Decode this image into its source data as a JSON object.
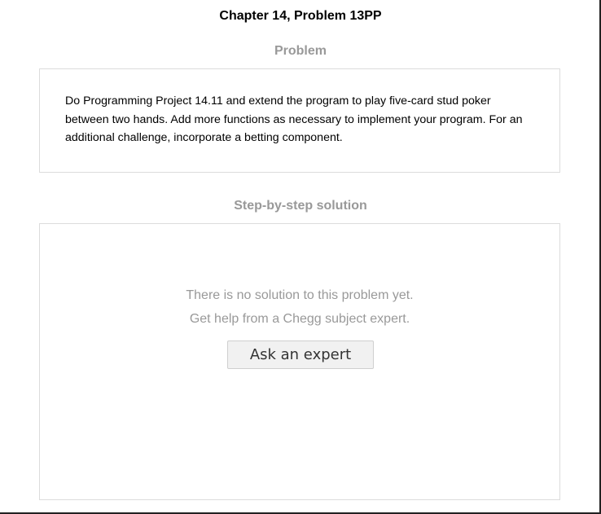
{
  "header": {
    "title": "Chapter 14, Problem 13PP"
  },
  "problem": {
    "heading": "Problem",
    "text": "Do Programming Project 14.11 and extend the program to play five-card stud poker between two hands. Add more functions as necessary to implement your program. For an additional challenge, incorporate a betting component."
  },
  "solution": {
    "heading": "Step-by-step solution",
    "message_line1": "There is no solution to this problem yet.",
    "message_line2": "Get help from a Chegg subject expert.",
    "ask_button_label": "Ask an expert"
  }
}
